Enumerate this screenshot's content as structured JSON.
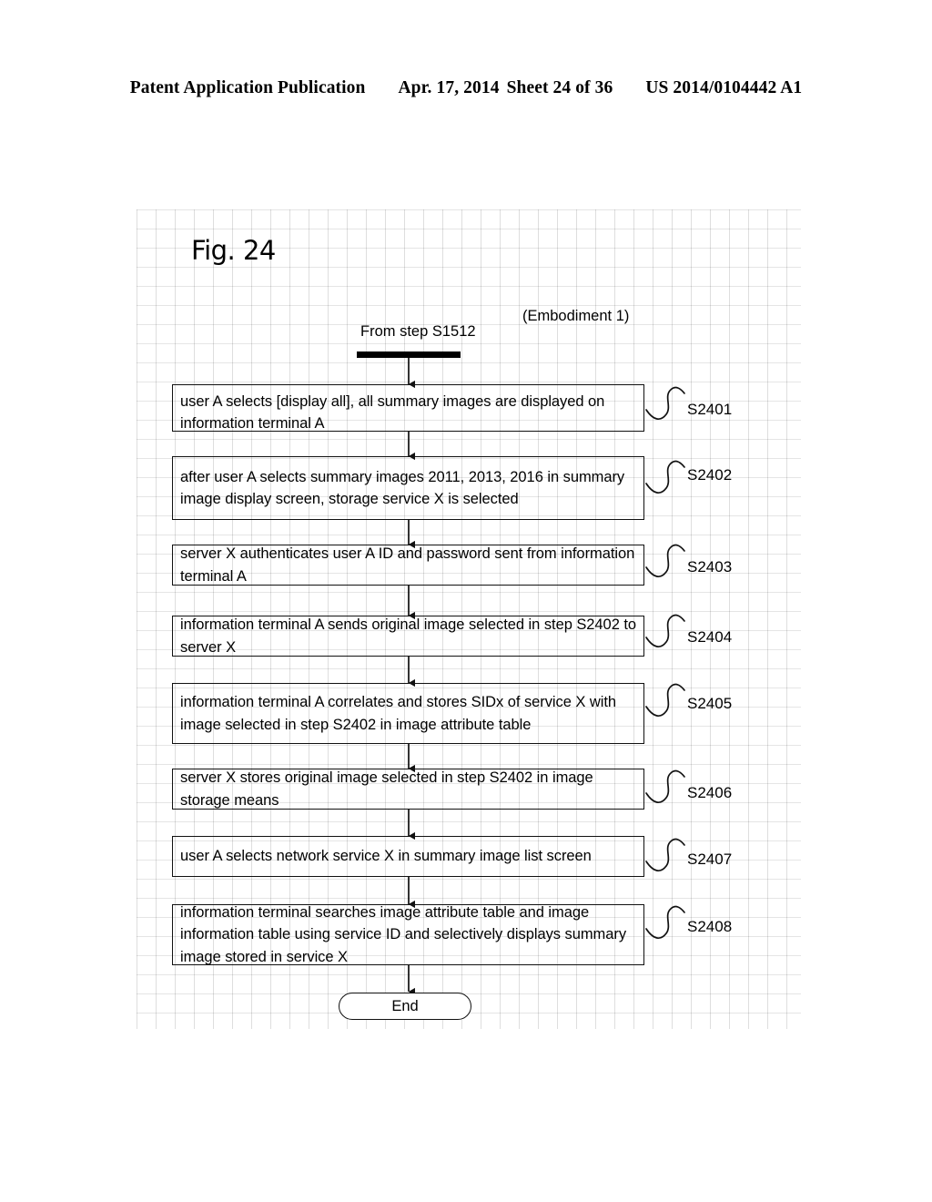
{
  "header": {
    "publication": "Patent Application Publication",
    "date": "Apr. 17, 2014",
    "sheet": "Sheet 24 of 36",
    "patent_number": "US 2014/0104442 A1"
  },
  "figure": {
    "title": "Fig. 24",
    "embodiment_label": "(Embodiment 1)",
    "entry_label": "From step S1512",
    "terminator_label": "End"
  },
  "flowchart": {
    "type": "flowchart",
    "orientation": "vertical",
    "entry": "From step S1512",
    "exit": "End",
    "steps": [
      {
        "id": "S2401",
        "text": "user A selects [display all], all summary images are displayed on information terminal A"
      },
      {
        "id": "S2402",
        "text": "after user A selects summary images 2011, 2013, 2016 in summary image display screen, storage service X is selected"
      },
      {
        "id": "S2403",
        "text": "server X authenticates user A ID and password sent from information terminal A"
      },
      {
        "id": "S2404",
        "text": "information terminal A sends original image selected in step S2402 to server X"
      },
      {
        "id": "S2405",
        "text": "information terminal A correlates and stores SIDx of service X with image selected in step S2402 in image attribute table"
      },
      {
        "id": "S2406",
        "text": "server X stores original image selected in step S2402 in image storage means"
      },
      {
        "id": "S2407",
        "text": "user A selects network service X in summary image list screen"
      },
      {
        "id": "S2408",
        "text": "information terminal searches image attribute table and image information table using service ID and selectively displays summary image stored in service X"
      }
    ]
  },
  "colors": {
    "ink": "#000000",
    "paper": "#ffffff"
  }
}
